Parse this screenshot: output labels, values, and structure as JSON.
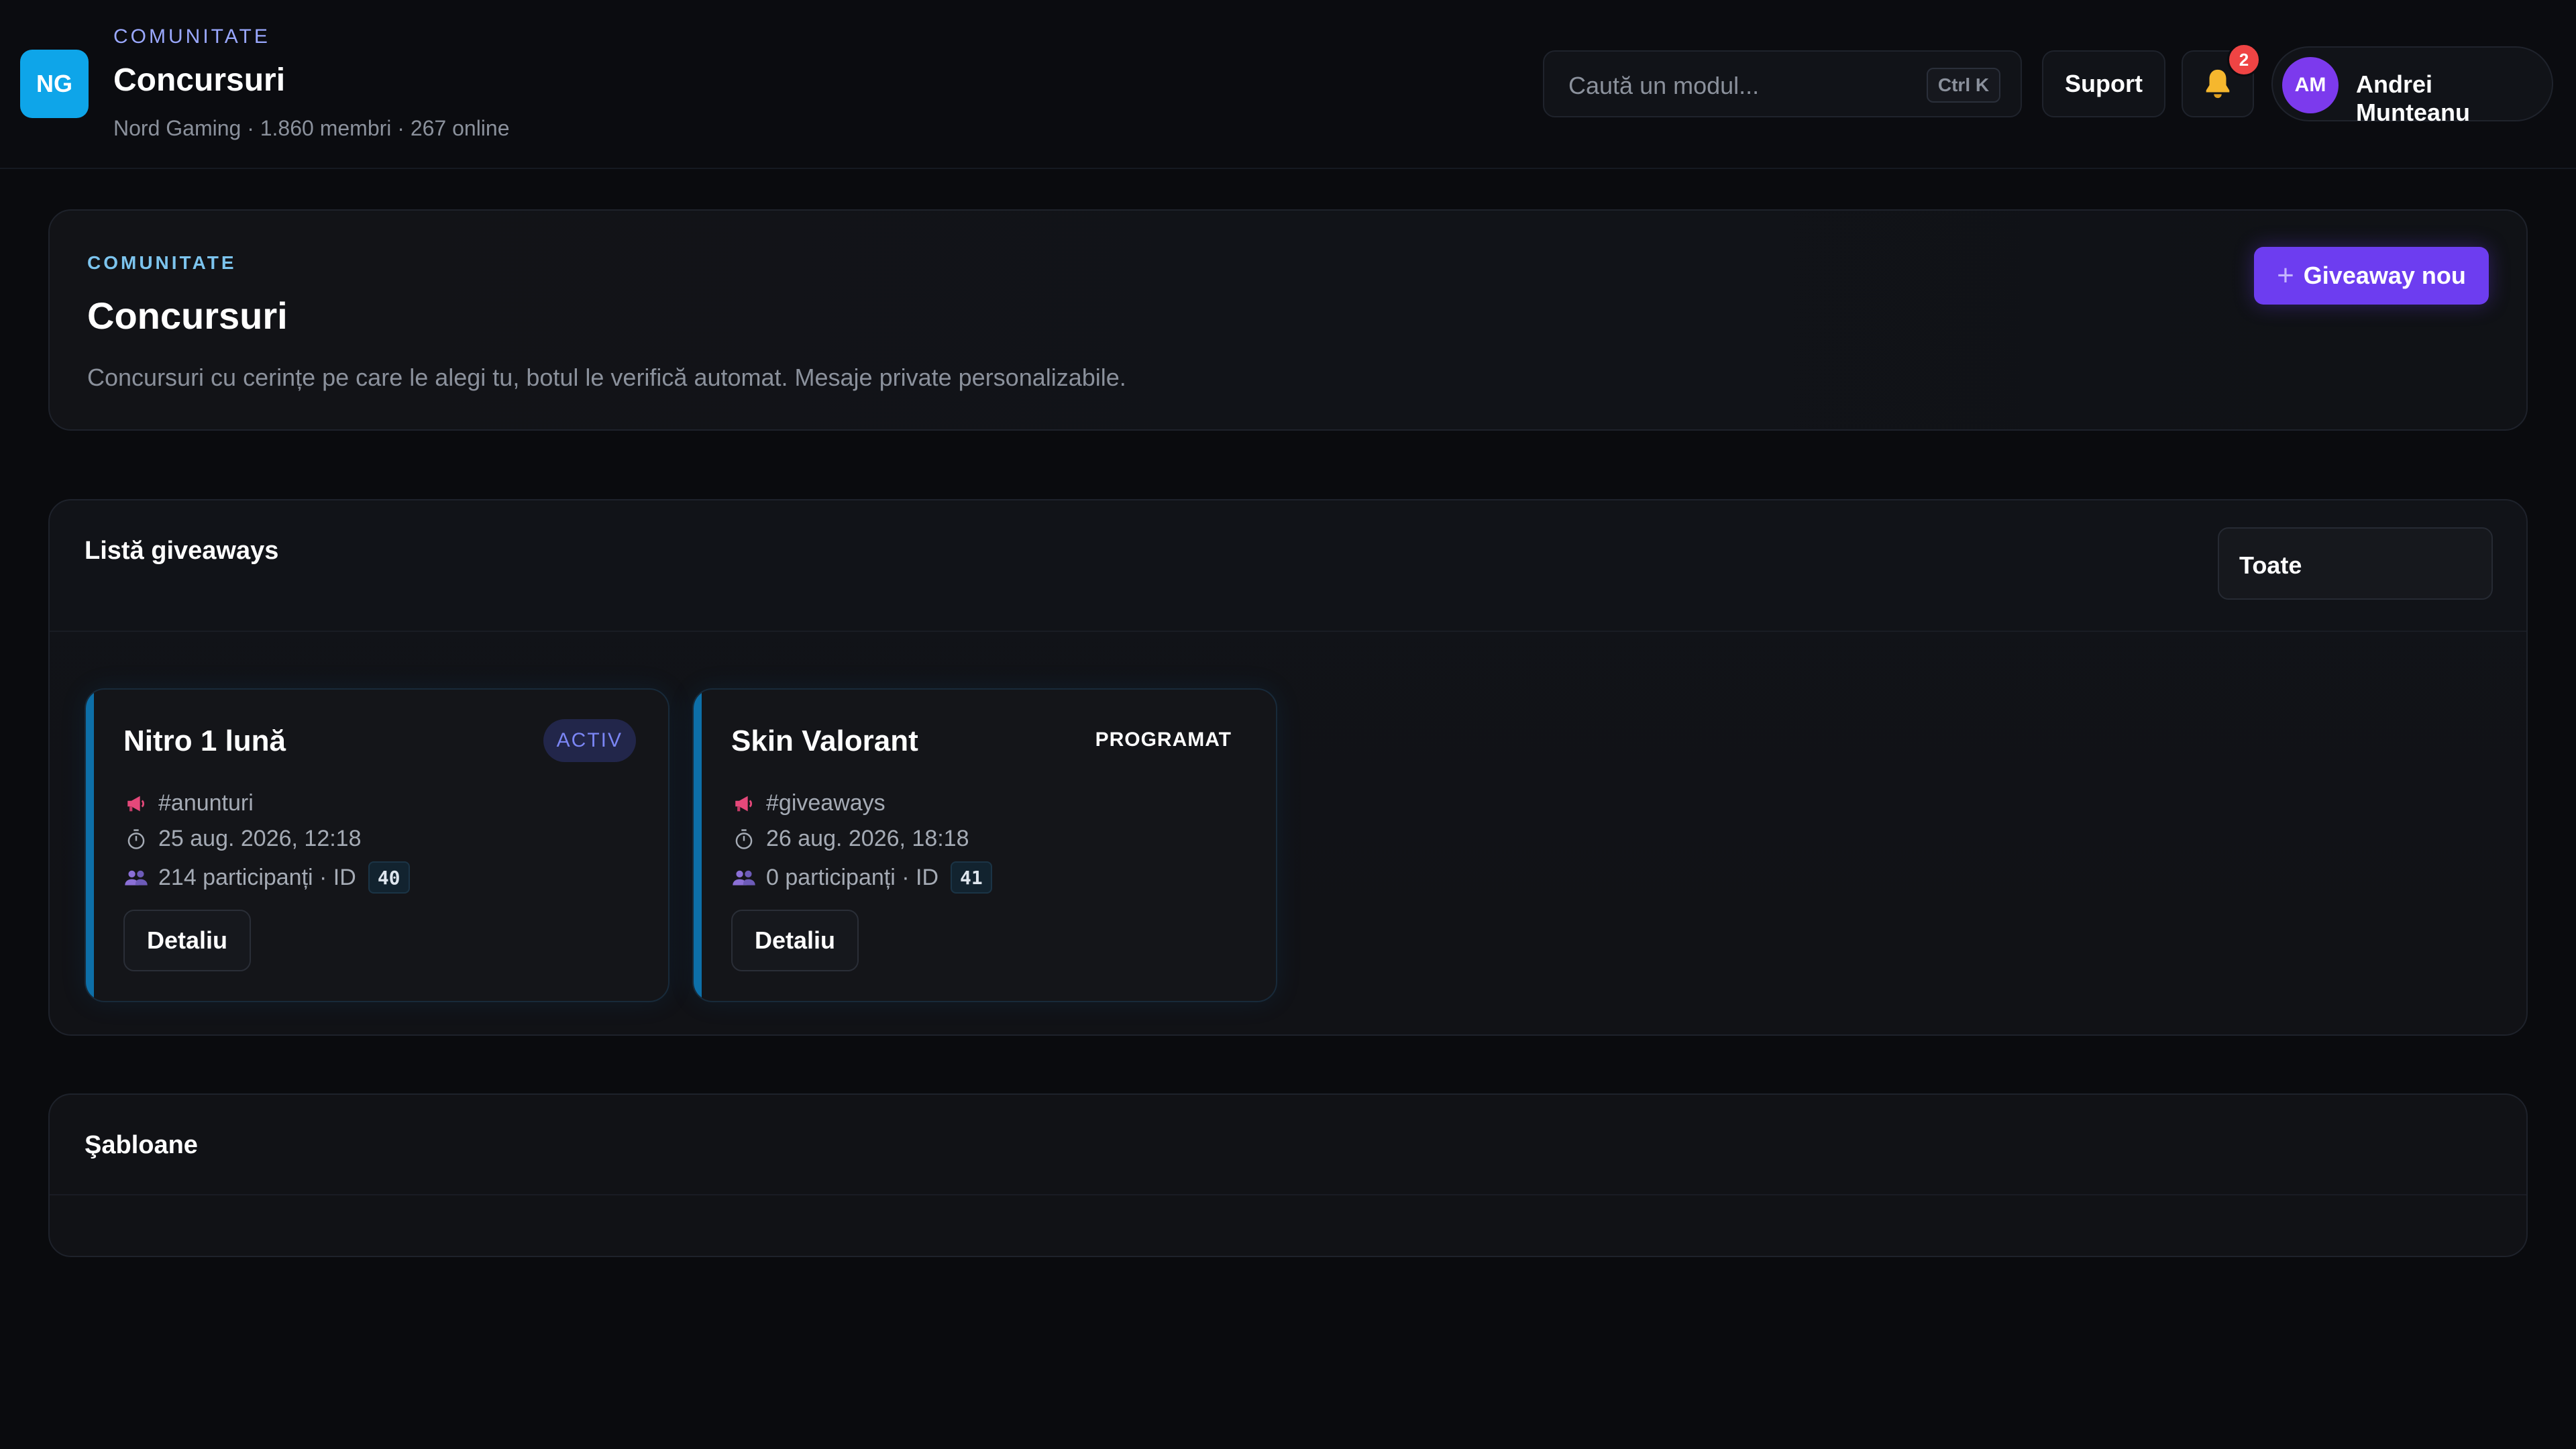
{
  "topbar": {
    "logo": "NG",
    "eyebrow": "COMUNITATE",
    "title": "Concursuri",
    "subtitle": "Nord Gaming · 1.860 membri · 267 online",
    "search_placeholder": "Caută un modul...",
    "search_shortcut": "Ctrl K",
    "support_label": "Suport",
    "notifications_count": "2",
    "user_initials": "AM",
    "user_name": "Andrei Munteanu",
    "bell_icon": "bell-icon"
  },
  "hero": {
    "eyebrow": "COMUNITATE",
    "title": "Concursuri",
    "description": "Concursuri cu cerințe pe care le alegi tu, botul le verifică automat. Mesaje private personalizabile.",
    "new_button_label": "Giveaway nou",
    "new_button_icon": "plus-icon"
  },
  "list": {
    "title": "Listă giveaways",
    "filter_value": "Toate",
    "giveaways": [
      {
        "title": "Nitro 1 lună",
        "status": "ACTIV",
        "channel": "#anunturi",
        "date": "25 aug. 2026, 12:18",
        "participants": "214 participanți · ID",
        "id": "40",
        "button": "Detaliu"
      },
      {
        "title": "Skin Valorant",
        "status": "PROGRAMAT",
        "channel": "#giveaways",
        "date": "26 aug. 2026, 18:18",
        "participants": "0 participanți · ID",
        "id": "41",
        "button": "Detaliu"
      }
    ]
  },
  "templates": {
    "title": "Şabloane"
  },
  "colors": {
    "accent": "#6d3df0",
    "logo": "#0ea5e9",
    "active_badge_text": "#7b86f5",
    "card_edge": "#0d6fa8",
    "notification": "#ef4444"
  }
}
